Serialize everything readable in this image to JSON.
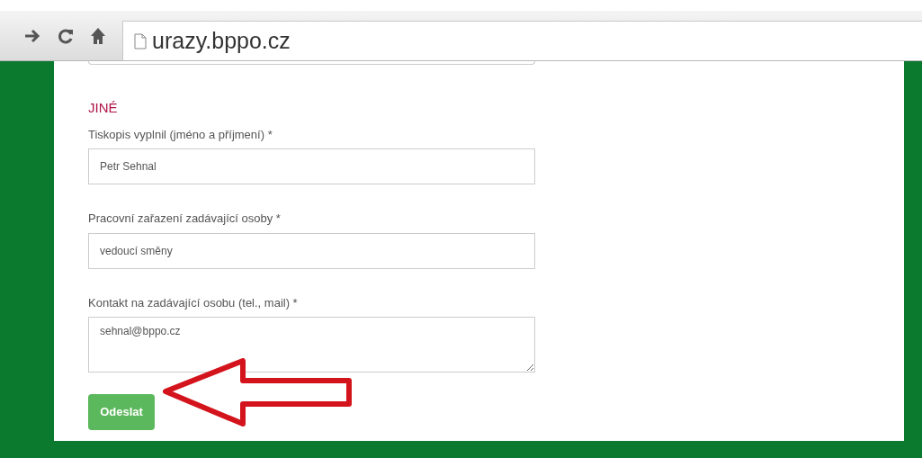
{
  "browser": {
    "address": "urazy.bppo.cz"
  },
  "form": {
    "section_title": "JINÉ",
    "fields": [
      {
        "kind": "input",
        "label": "Tiskopis vyplnil (jméno a příjmení) *",
        "value": "Petr Sehnal"
      },
      {
        "kind": "input",
        "label": "Pracovní zařazení zadávající osoby *",
        "value": "vedoucí směny"
      },
      {
        "kind": "textarea",
        "label": "Kontakt na zadávající osobu (tel., mail) *",
        "value": "sehnal@bppo.cz"
      }
    ],
    "submit": "Odeslat"
  }
}
